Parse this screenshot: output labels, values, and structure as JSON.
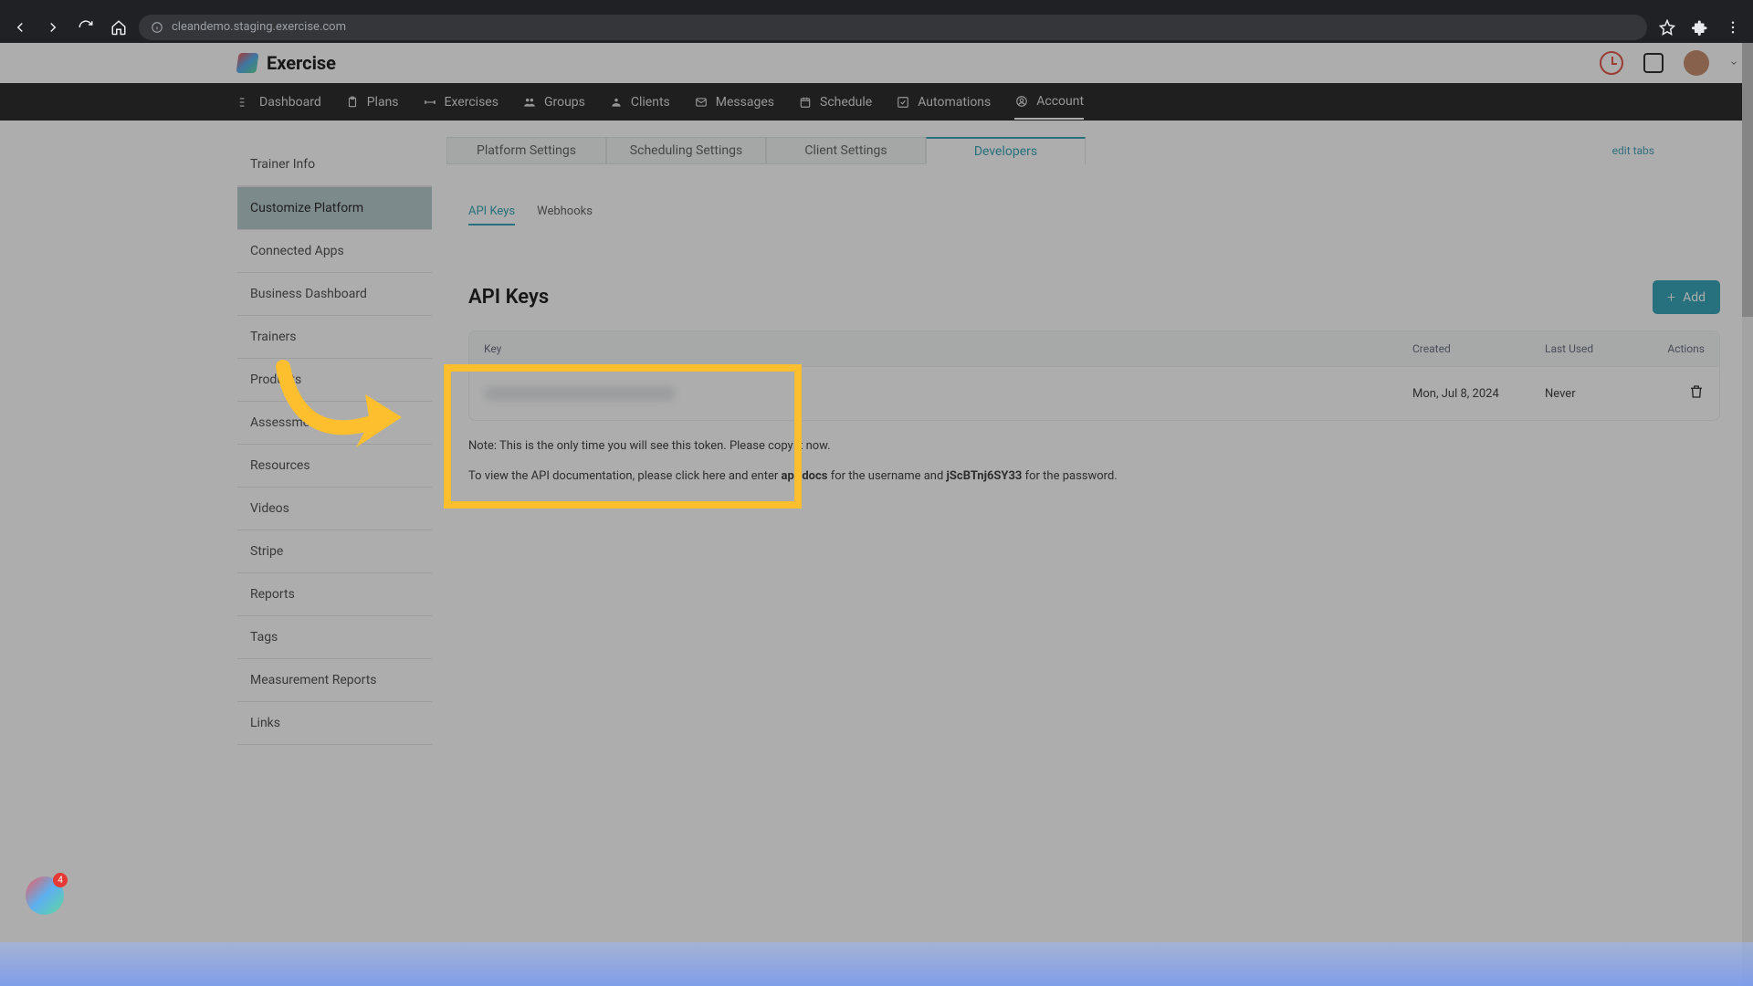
{
  "browser": {
    "url": "cleandemo.staging.exercise.com"
  },
  "brand": {
    "name": "Exercise"
  },
  "main_nav": [
    {
      "label": "Dashboard"
    },
    {
      "label": "Plans"
    },
    {
      "label": "Exercises"
    },
    {
      "label": "Groups"
    },
    {
      "label": "Clients"
    },
    {
      "label": "Messages"
    },
    {
      "label": "Schedule"
    },
    {
      "label": "Automations"
    },
    {
      "label": "Account"
    }
  ],
  "sidebar": {
    "items": [
      {
        "label": "Trainer Info"
      },
      {
        "label": "Customize Platform"
      },
      {
        "label": "Connected Apps"
      },
      {
        "label": "Business Dashboard"
      },
      {
        "label": "Trainers"
      },
      {
        "label": "Products"
      },
      {
        "label": "Assessments"
      },
      {
        "label": "Resources"
      },
      {
        "label": "Videos"
      },
      {
        "label": "Stripe"
      },
      {
        "label": "Reports"
      },
      {
        "label": "Tags"
      },
      {
        "label": "Measurement Reports"
      },
      {
        "label": "Links"
      }
    ]
  },
  "settings_tabs": {
    "items": [
      {
        "label": "Platform Settings"
      },
      {
        "label": "Scheduling Settings"
      },
      {
        "label": "Client Settings"
      },
      {
        "label": "Developers"
      }
    ],
    "edit_label": "edit tabs"
  },
  "sub_tabs": {
    "items": [
      {
        "label": "API Keys"
      },
      {
        "label": "Webhooks"
      }
    ]
  },
  "api_keys": {
    "title": "API Keys",
    "add_label": "Add",
    "columns": {
      "key": "Key",
      "created": "Created",
      "last_used": "Last Used",
      "actions": "Actions"
    },
    "rows": [
      {
        "created": "Mon, Jul 8, 2024",
        "last_used": "Never"
      }
    ],
    "note": "Note: This is the only time you will see this token. Please copy it now.",
    "doc_pre": "To view the API documentation, please click here and enter ",
    "doc_user": "api-docs",
    "doc_mid": " for the username and ",
    "doc_pass": "jScBTnj6SY33",
    "doc_post": " for the password."
  },
  "float_badge": {
    "count": "4"
  }
}
